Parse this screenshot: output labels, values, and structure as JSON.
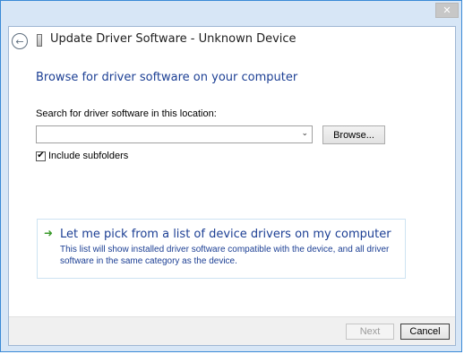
{
  "window": {
    "title": "Update Driver Software - Unknown Device",
    "close_glyph": "✕"
  },
  "page": {
    "heading": "Browse for driver software on your computer",
    "search_label": "Search for driver software in this location:",
    "path_value": "",
    "browse_label": "Browse...",
    "include_subfolders_label": "Include subfolders",
    "include_subfolders_checked": true
  },
  "pick": {
    "title": "Let me pick from a list of device drivers on my computer",
    "description": "This list will show installed driver software compatible with the device, and all driver software in the same category as the device."
  },
  "footer": {
    "next_label": "Next",
    "next_enabled": false,
    "cancel_label": "Cancel"
  },
  "icons": {
    "back": "back-arrow-icon",
    "device": "device-icon",
    "pick_arrow": "green-arrow-icon",
    "dropdown": "chevron-down-icon",
    "close": "close-icon",
    "check": "checkmark-icon"
  },
  "colors": {
    "accent_text": "#1c3f94",
    "window_frame": "#d7e6f6",
    "pick_arrow": "#3a9a2a"
  }
}
